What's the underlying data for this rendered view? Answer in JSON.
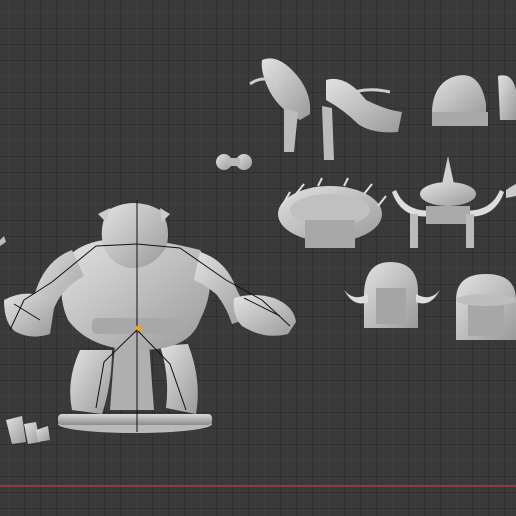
{
  "viewport": {
    "background": "#3a3a3a",
    "grid_color": "#4a4a4a",
    "x_axis_color": "#8a3b45",
    "model_color": "#c8c8c8",
    "armature_color": "#111111",
    "origin_color": "#f0a020"
  },
  "objects": [
    {
      "name": "orc-body",
      "icon": "ogre-figure"
    },
    {
      "name": "hair-tail-left",
      "icon": "hair"
    },
    {
      "name": "hair-tail-right",
      "icon": "hair"
    },
    {
      "name": "helmet-cap",
      "icon": "helmet"
    },
    {
      "name": "goggles",
      "icon": "goggles"
    },
    {
      "name": "fur-crown-helmet",
      "icon": "helmet"
    },
    {
      "name": "spiked-horned-helmet",
      "icon": "helmet"
    },
    {
      "name": "horned-dome-helmet",
      "icon": "helmet"
    },
    {
      "name": "round-helmet",
      "icon": "helmet"
    },
    {
      "name": "toes-pieces",
      "icon": "toes"
    }
  ]
}
